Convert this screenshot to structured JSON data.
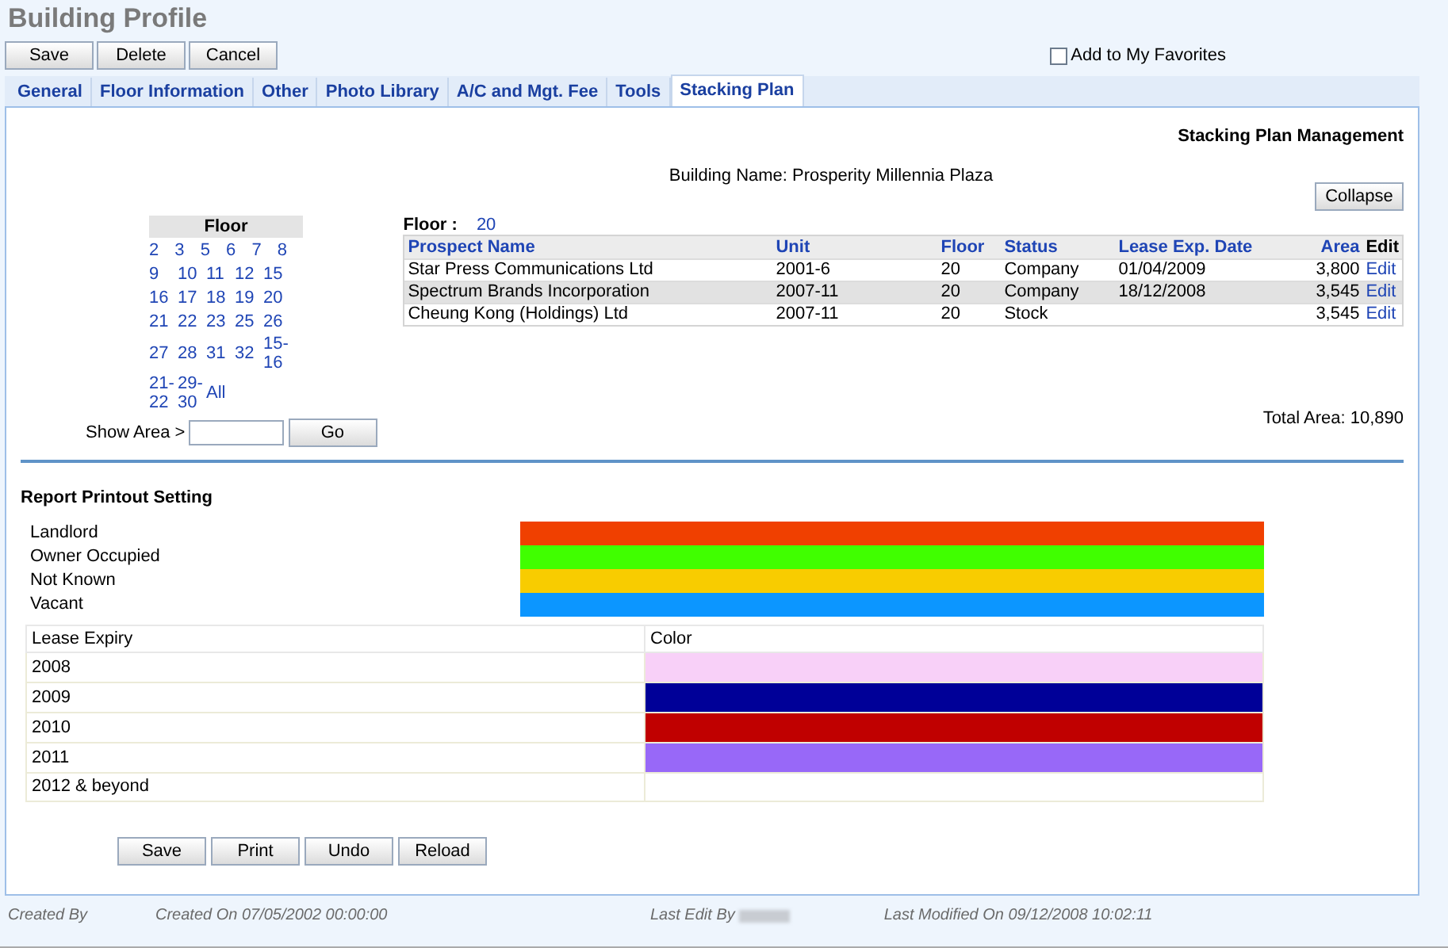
{
  "title": "Building Profile",
  "top_buttons": [
    "Save",
    "Delete",
    "Cancel"
  ],
  "favorite": {
    "label": "Add to My Favorites",
    "checked": false
  },
  "tabs": [
    {
      "label": "General",
      "selected": false
    },
    {
      "label": "Floor Information",
      "selected": false
    },
    {
      "label": "Other",
      "selected": false
    },
    {
      "label": "Photo Library",
      "selected": false
    },
    {
      "label": "A/C and Mgt. Fee",
      "selected": false
    },
    {
      "label": "Tools",
      "selected": false
    },
    {
      "label": "Stacking Plan",
      "selected": true
    }
  ],
  "panel_heading": "Stacking Plan Management",
  "building_name": "Building Name: Prosperity Millennia Plaza",
  "collapse_button": "Collapse",
  "floor_picker": {
    "heading": "Floor",
    "rows": [
      [
        "2",
        "3",
        "5",
        "6",
        "7",
        "8"
      ],
      [
        "9",
        "10",
        "11",
        "12",
        "15"
      ],
      [
        "16",
        "17",
        "18",
        "19",
        "20"
      ],
      [
        "21",
        "22",
        "23",
        "25",
        "26"
      ],
      [
        "27",
        "28",
        "31",
        "32",
        "15-16"
      ],
      [
        "21-22",
        "29-30",
        "All"
      ]
    ],
    "show_area_label": "Show Area >",
    "go_button": "Go"
  },
  "floor_label": "Floor :",
  "floor_value": "20",
  "table": {
    "columns": [
      "Prospect Name",
      "Unit",
      "Floor",
      "Status",
      "Lease Exp. Date",
      "Area",
      "Edit"
    ],
    "rows": [
      {
        "cells": [
          "Star Press Communications Ltd",
          "2001-6",
          "20",
          "Company",
          "01/04/2009",
          "3,800"
        ],
        "action": "Edit",
        "highlighted": false
      },
      {
        "cells": [
          "Spectrum Brands Incorporation",
          "2007-11",
          "20",
          "Company",
          "18/12/2008",
          "3,545"
        ],
        "action": "Edit",
        "highlighted": true
      },
      {
        "cells": [
          "Cheung Kong (Holdings) Ltd",
          "2007-11",
          "20",
          "Stock",
          "",
          "3,545"
        ],
        "action": "Edit",
        "highlighted": false
      }
    ]
  },
  "total_area": "Total Area: 10,890",
  "report_heading": "Report Printout Setting",
  "legend": [
    {
      "label": "Landlord",
      "color": "#f04000"
    },
    {
      "label": "Owner Occupied",
      "color": "#40ff00"
    },
    {
      "label": "Not Known",
      "color": "#f8cc00"
    },
    {
      "label": "Vacant",
      "color": "#0c96ff"
    }
  ],
  "lease_table": {
    "columns": [
      "Lease Expiry",
      "Color"
    ],
    "rows": [
      {
        "label": "2008",
        "color": "#f8d0f8"
      },
      {
        "label": "2009",
        "color": "#000098"
      },
      {
        "label": "2010",
        "color": "#c00000"
      },
      {
        "label": "2011",
        "color": "#9868f8"
      },
      {
        "label": "2012 & beyond"
      }
    ]
  },
  "bottom_buttons": [
    "Save",
    "Print",
    "Undo",
    "Reload"
  ],
  "footer": {
    "created_by": "Created By",
    "created_on": "Created On 07/05/2002 00:00:00",
    "last_edit_by": "Last Edit By",
    "last_modified": "Last Modified On 09/12/2008 10:02:11"
  }
}
